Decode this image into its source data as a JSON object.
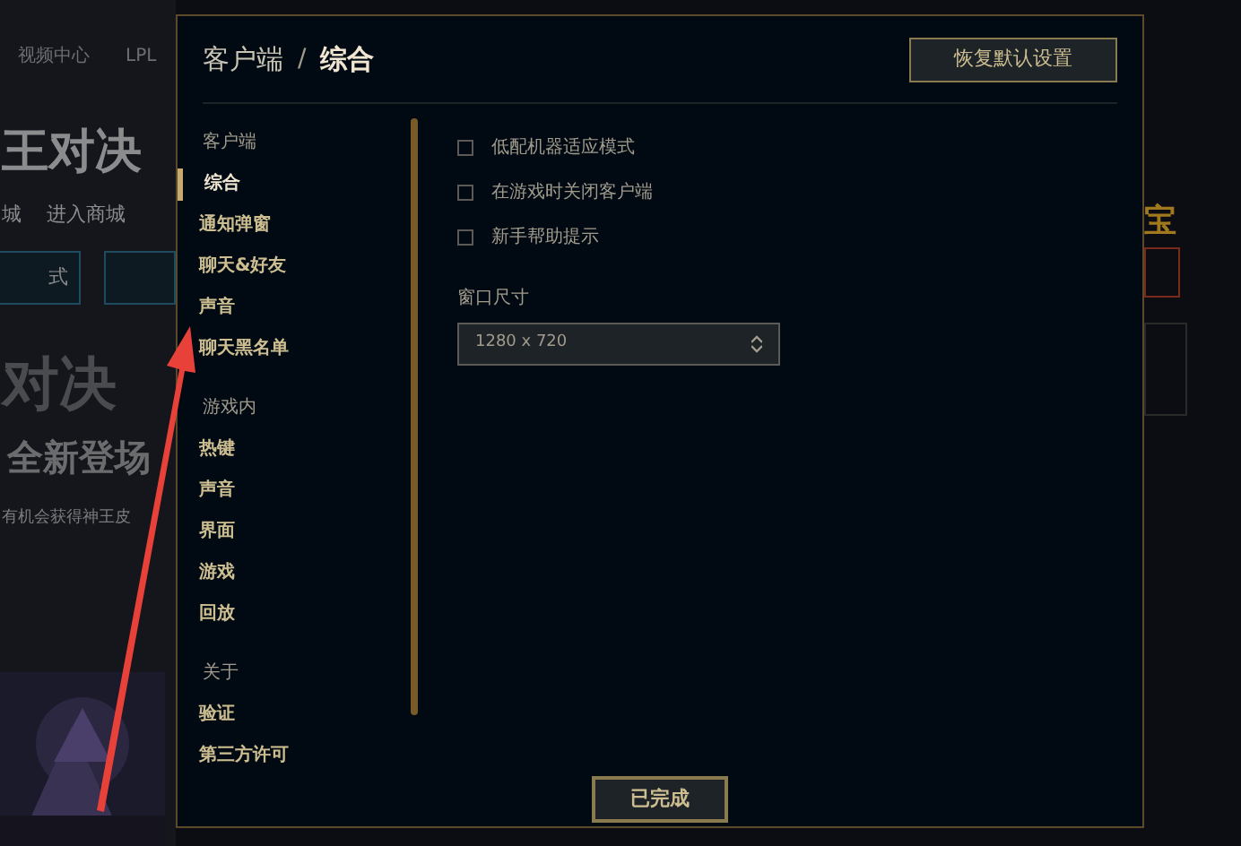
{
  "background": {
    "nav": [
      "视频中心",
      "LPL"
    ],
    "banner_title": "王对决",
    "banner_links": [
      "城",
      "进入商城"
    ],
    "button": "式",
    "promo_title": "对决",
    "promo_subtitle": "全新登场",
    "promo_text": "有机会获得神王皮",
    "right_title": "宝"
  },
  "dialog": {
    "breadcrumb": [
      "客户端",
      "综合"
    ],
    "breadcrumb_separator": "/",
    "reset_button": "恢复默认设置",
    "sidebar": [
      {
        "kind": "section",
        "label": "客户端"
      },
      {
        "kind": "item",
        "label": "综合",
        "selected": true
      },
      {
        "kind": "item",
        "label": "通知弹窗",
        "selected": false
      },
      {
        "kind": "item",
        "label": "聊天&好友",
        "selected": false
      },
      {
        "kind": "item",
        "label": "声音",
        "selected": false
      },
      {
        "kind": "item",
        "label": "聊天黑名单",
        "selected": false
      },
      {
        "kind": "section",
        "label": "游戏内"
      },
      {
        "kind": "item",
        "label": "热键",
        "selected": false
      },
      {
        "kind": "item",
        "label": "声音",
        "selected": false
      },
      {
        "kind": "item",
        "label": "界面",
        "selected": false
      },
      {
        "kind": "item",
        "label": "游戏",
        "selected": false
      },
      {
        "kind": "item",
        "label": "回放",
        "selected": false
      },
      {
        "kind": "section",
        "label": "关于"
      },
      {
        "kind": "item",
        "label": "验证",
        "selected": false
      },
      {
        "kind": "item",
        "label": "第三方许可",
        "selected": false
      }
    ],
    "options": [
      {
        "label": "低配机器适应模式",
        "checked": false
      },
      {
        "label": "在游戏时关闭客户端",
        "checked": false
      },
      {
        "label": "新手帮助提示",
        "checked": false
      }
    ],
    "window_size": {
      "label": "窗口尺寸",
      "value": "1280 x 720"
    },
    "done_button": "已完成"
  }
}
